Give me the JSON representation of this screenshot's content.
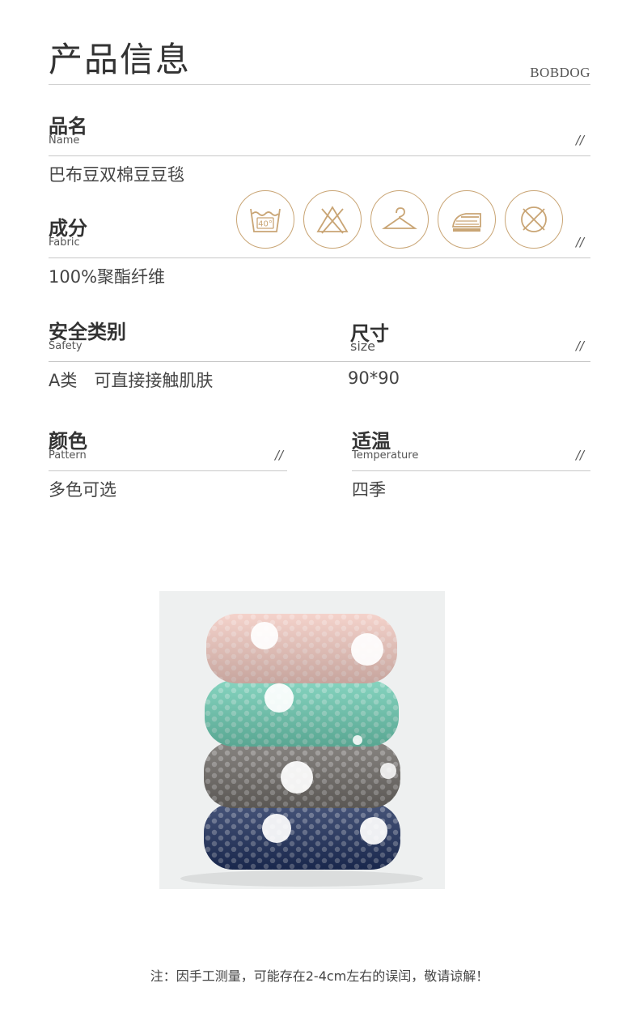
{
  "header": {
    "title": "产品信息",
    "brand": "BOBDOG"
  },
  "fields": {
    "name": {
      "label_cn": "品名",
      "label_en": "Name",
      "value": "巴布豆双棉豆豆毯"
    },
    "material": {
      "label_cn": "成分",
      "label_en": "Fabric",
      "value": "100%聚酯纤维"
    },
    "safety": {
      "label_cn": "安全类别",
      "label_en": "Safety",
      "value": "A类　可直接接触肌肤"
    },
    "size": {
      "label_cn": "尺寸",
      "label_en": "size",
      "value": "90*90"
    },
    "color": {
      "label_cn": "颜色",
      "label_en": "Pattern",
      "value": "多色可选"
    },
    "temperature": {
      "label_cn": "适温",
      "label_en": "Temperature",
      "value": "四季"
    }
  },
  "slash_mark": "//",
  "care_icons": [
    {
      "name": "wash-40-icon",
      "text": "40°"
    },
    {
      "name": "no-bleach-icon"
    },
    {
      "name": "hang-dry-icon"
    },
    {
      "name": "iron-icon"
    },
    {
      "name": "no-dry-clean-icon"
    }
  ],
  "colors": {
    "accent_gold": "#c9a575",
    "text": "#3a3a3a",
    "rule": "#c8c8c8"
  },
  "product_image": {
    "stack_colors": [
      "#f2c9c0",
      "#6ccbb2",
      "#6e6a66",
      "#1e2f5c"
    ]
  },
  "footer": {
    "note": "注：因手工测量，可能存在2-4cm左右的误闰，敬请谅解！"
  }
}
